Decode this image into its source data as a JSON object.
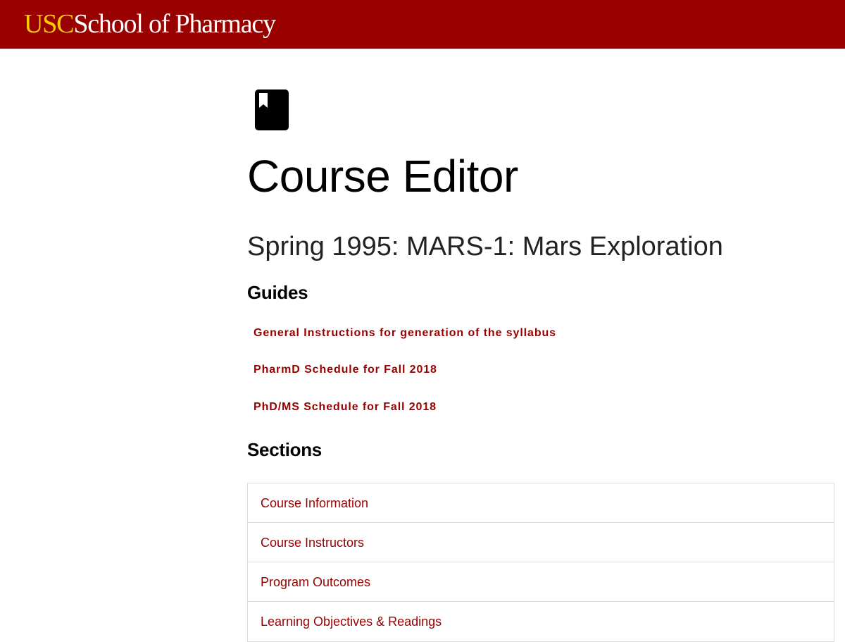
{
  "header": {
    "logo_usc": "USC",
    "logo_rest": "School of Pharmacy",
    "background_color": "#990000",
    "usc_color": "#ffcc00"
  },
  "main": {
    "icon": "bookmark-book-icon",
    "title": "Course Editor",
    "course_subtitle": "Spring 1995: MARS-1: Mars Exploration",
    "guides_heading": "Guides",
    "guides": [
      {
        "label": "General Instructions for generation of the syllabus"
      },
      {
        "label": "PharmD Schedule for Fall 2018"
      },
      {
        "label": "PhD/MS Schedule for Fall 2018"
      }
    ],
    "sections_heading": "Sections",
    "sections": [
      {
        "label": "Course Information"
      },
      {
        "label": "Course Instructors"
      },
      {
        "label": "Program Outcomes"
      },
      {
        "label": "Learning Objectives & Readings"
      }
    ],
    "link_color": "#990000"
  }
}
